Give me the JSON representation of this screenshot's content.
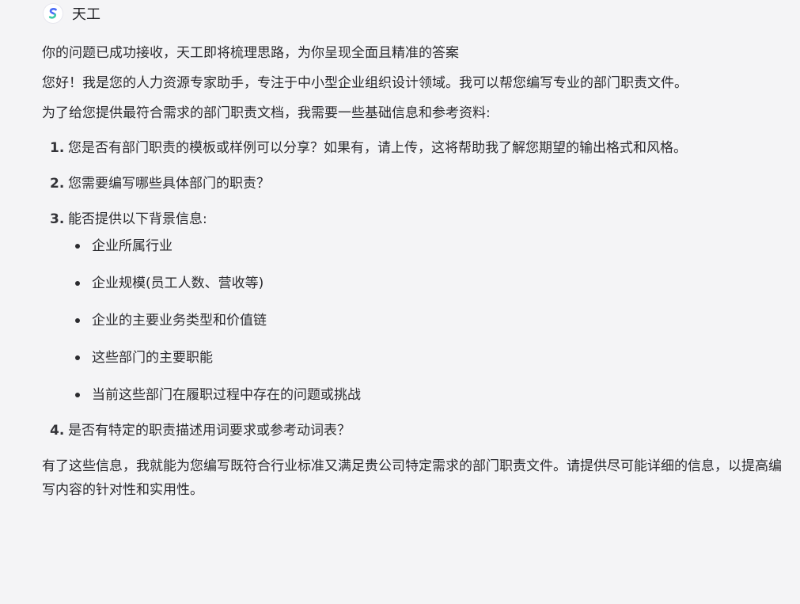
{
  "assistant": {
    "name": "天工",
    "logo_icon": "tiangong-logo-icon",
    "logo_colors": [
      "#4a6cf7",
      "#3ec9a7"
    ]
  },
  "message": {
    "status_text": "你的问题已成功接收，天工即将梳理思路，为你呈现全面且精准的答案",
    "intro": "您好！我是您的人力资源专家助手，专注于中小型企业组织设计领域。我可以帮您编写专业的部门职责文件。",
    "lead": "为了给您提供最符合需求的部门职责文档，我需要一些基础信息和参考资料:",
    "questions": [
      {
        "number": "1.",
        "text": "您是否有部门职责的模板或样例可以分享？如果有，请上传，这将帮助我了解您期望的输出格式和风格。"
      },
      {
        "number": "2.",
        "text": "您需要编写哪些具体部门的职责？"
      },
      {
        "number": "3.",
        "text": "能否提供以下背景信息:",
        "items": [
          "企业所属行业",
          "企业规模(员工人数、营收等)",
          "企业的主要业务类型和价值链",
          "这些部门的主要职能",
          "当前这些部门在履职过程中存在的问题或挑战"
        ]
      },
      {
        "number": "4.",
        "text": "是否有特定的职责描述用词要求或参考动词表？"
      }
    ],
    "closing": "有了这些信息，我就能为您编写既符合行业标准又满足贵公司特定需求的部门职责文件。请提供尽可能详细的信息，以提高编写内容的针对性和实用性。"
  }
}
